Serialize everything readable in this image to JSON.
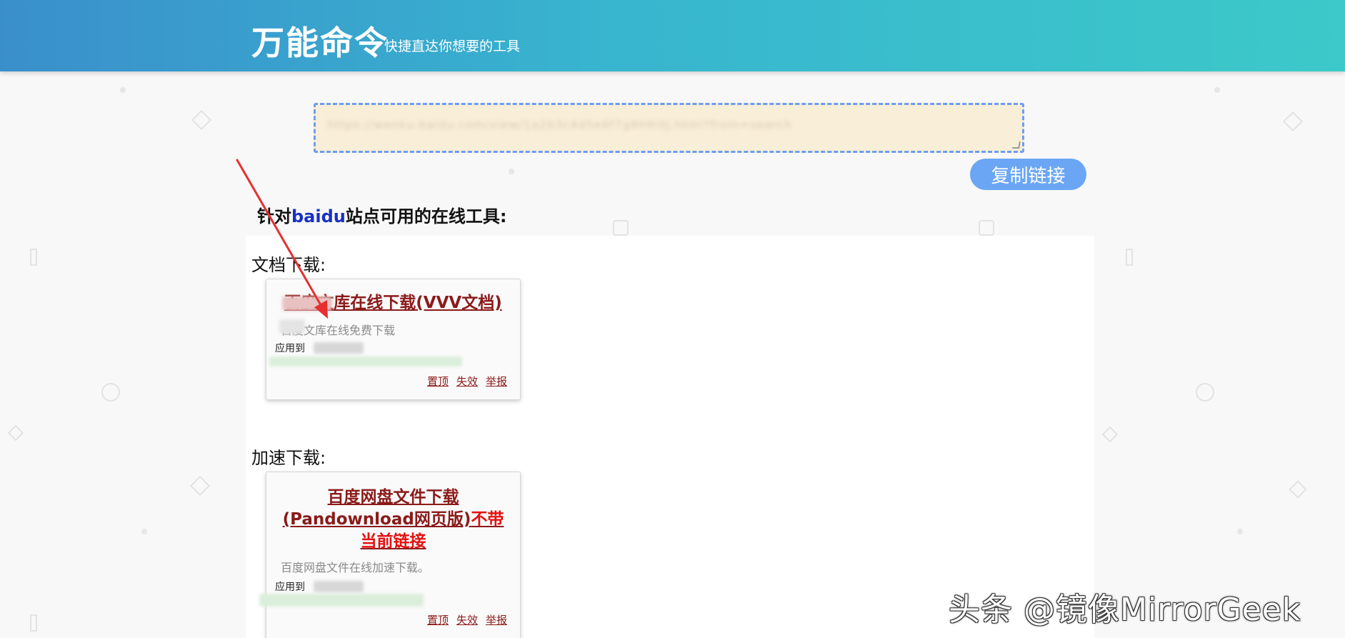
{
  "header": {
    "brand": "万能命令",
    "slogan": "快捷直达你想要的工具"
  },
  "url_box": {
    "value": "https://wenku.baidu.com/view/1a2b3c4d5e6f7g8h9i0j.html?from=search"
  },
  "copy_button": {
    "label": "复制链接"
  },
  "section_title": {
    "prefix": "针对",
    "site": "baidu",
    "suffix": "站点可用的在线工具:"
  },
  "categories": [
    {
      "label": "文档下载:",
      "card": {
        "title": "百度文库在线下载(VVV文档)",
        "title_extra": "",
        "desc": "百度文库在线免费下载",
        "apply_label": "应用到"
      }
    },
    {
      "label": "加速下载:",
      "card": {
        "title": "百度网盘文件下载(Pandownload网页版)",
        "title_extra": "不带当前链接",
        "desc": "百度网盘文件在线加速下载。",
        "apply_label": "应用到"
      }
    }
  ],
  "card_actions": {
    "top": "置顶",
    "invalid": "失效",
    "report": "举报"
  },
  "watermark": "头条 @镜像MirrorGeek",
  "colors": {
    "header_start": "#3a8fcb",
    "header_end": "#3cc9c9",
    "link": "#8b1a1a",
    "accent_red": "#e41010",
    "button": "#6aa6f4"
  }
}
